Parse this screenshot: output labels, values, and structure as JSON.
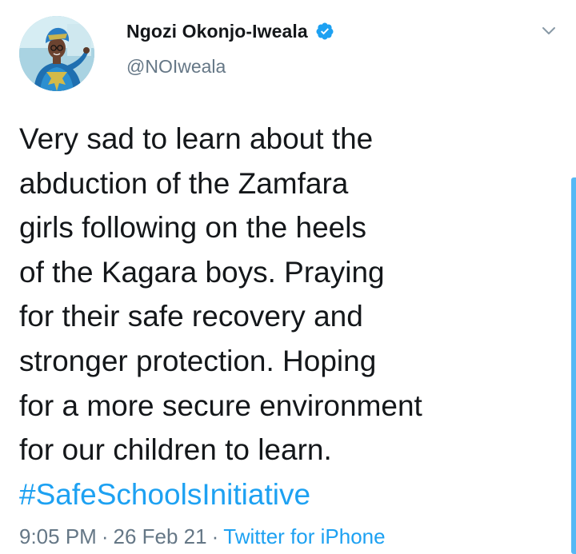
{
  "tweet": {
    "author": {
      "display_name": "Ngozi Okonjo-Iweala",
      "handle": "@NOIweala",
      "verified": true,
      "avatar_icon": "profile-photo"
    },
    "body_lines": [
      "Very sad to learn about the",
      "abduction of the Zamfara",
      "girls following on the heels",
      "of the Kagara boys. Praying",
      "for their safe recovery and",
      "stronger protection. Hoping",
      "for a more secure environment",
      "for our children to learn."
    ],
    "hashtag": "#SafeSchoolsInitiative",
    "time": "9:05 PM",
    "date": "26 Feb 21",
    "separator": "·",
    "source": "Twitter for iPhone"
  },
  "colors": {
    "text": "#14171a",
    "secondary": "#657786",
    "accent": "#1da1f2"
  }
}
